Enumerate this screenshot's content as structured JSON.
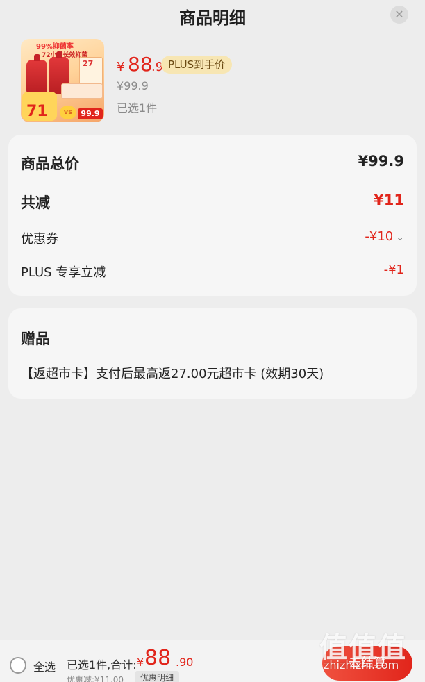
{
  "header": {
    "title": "商品明细",
    "close_icon": "close-icon"
  },
  "product": {
    "image_texts": {
      "promo": "99%抑菌率",
      "subpromo": "72小时长效抑菌",
      "box_number": "27",
      "badge_price": "71",
      "vs": "vs",
      "box_price": "99.9"
    },
    "price_symbol": "¥",
    "price_int": "88",
    "price_dec": ".9",
    "plus_tag": "PLUS到手价",
    "original_price": "¥99.9",
    "selected_count": "已选1件"
  },
  "summary": {
    "total_label": "商品总价",
    "total_value": "¥99.9",
    "reduction_label": "共减",
    "reduction_value": "¥11",
    "coupon_label": "优惠券",
    "coupon_value": "-¥10",
    "plus_label": "PLUS 专享立减",
    "plus_value": "-¥1"
  },
  "gift": {
    "title": "赠品",
    "text": "【返超市卡】支付后最高返27.00元超市卡 (效期30天)"
  },
  "bottom": {
    "select_all": "全选",
    "summary_label": "已选1件,合计:",
    "sum_symbol": "¥",
    "sum_int": "88",
    "sum_dec": ".90",
    "discount_text": "优惠减:¥11.00",
    "detail_button": "优惠明细",
    "checkout_button": "去结算"
  },
  "watermark": {
    "logo": "值值值",
    "url": "zhizhizhi.com"
  },
  "colors": {
    "accent_red": "#e1251b",
    "plus_tag_bg": "#f7e6b3",
    "background": "#ededed",
    "card_bg": "#f6f6f6"
  }
}
